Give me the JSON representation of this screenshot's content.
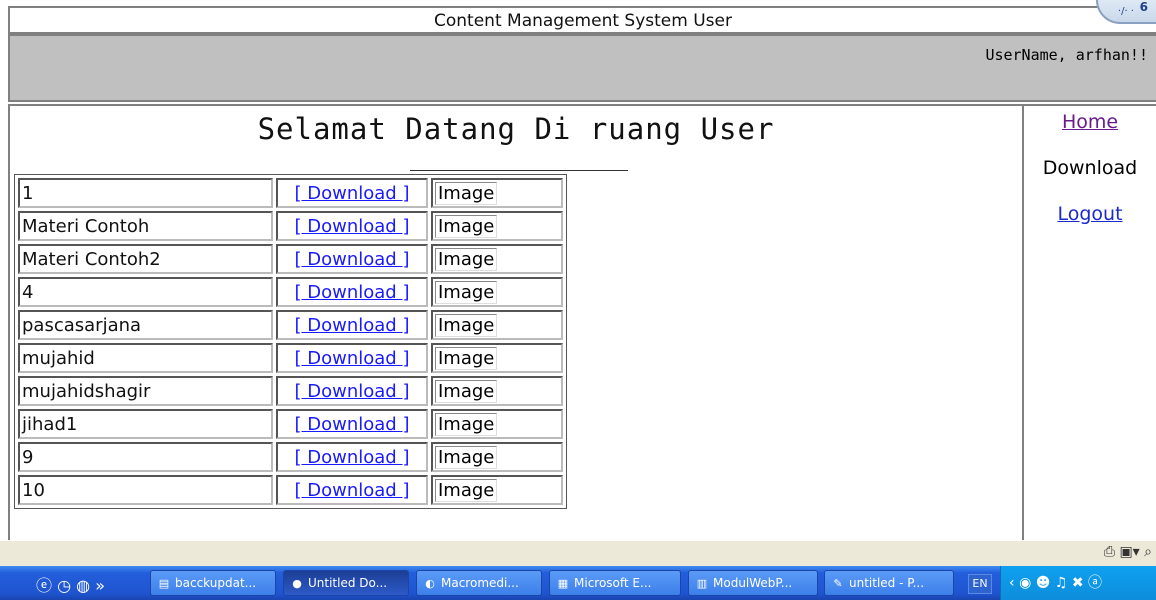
{
  "header": {
    "title": "Content Management System User",
    "user_greeting": "UserName, arfhan!!"
  },
  "main": {
    "heading": "Selamat Datang Di ruang User",
    "rows": [
      {
        "title": "1",
        "link_label": "[ Download ]",
        "image_alt": "Image"
      },
      {
        "title": "Materi Contoh",
        "link_label": "[ Download ]",
        "image_alt": "Image"
      },
      {
        "title": "Materi Contoh2",
        "link_label": "[ Download ]",
        "image_alt": "Image"
      },
      {
        "title": "4",
        "link_label": "[ Download ]",
        "image_alt": "Image"
      },
      {
        "title": "pascasarjana",
        "link_label": "[ Download ]",
        "image_alt": "Image"
      },
      {
        "title": "mujahid",
        "link_label": "[ Download ]",
        "image_alt": "Image"
      },
      {
        "title": "mujahidshagir",
        "link_label": "[ Download ]",
        "image_alt": "Image"
      },
      {
        "title": "jihad1",
        "link_label": "[ Download ]",
        "image_alt": "Image"
      },
      {
        "title": "9",
        "link_label": "[ Download ]",
        "image_alt": "Image"
      },
      {
        "title": "10",
        "link_label": "[ Download ]",
        "image_alt": "Image"
      }
    ]
  },
  "sidebar": {
    "home": "Home",
    "download": "Download",
    "logout": "Logout"
  },
  "clock": {
    "number": "6"
  },
  "taskbar": {
    "tasks": [
      {
        "label": "bacckupdat...",
        "icon": "folder-icon"
      },
      {
        "label": "Untitled Do...",
        "icon": "flash-icon"
      },
      {
        "label": "Macromedi...",
        "icon": "dreamweaver-icon"
      },
      {
        "label": "Microsoft E...",
        "icon": "excel-icon"
      },
      {
        "label": "ModulWebP...",
        "icon": "word-icon"
      },
      {
        "label": "untitled - P...",
        "icon": "paint-icon"
      }
    ],
    "lang": "EN"
  },
  "colors": {
    "link": "#1a1aff",
    "visited_link": "#6a1a8a",
    "header_gray": "#c0c0c0",
    "taskbar_blue": "#245edb"
  }
}
